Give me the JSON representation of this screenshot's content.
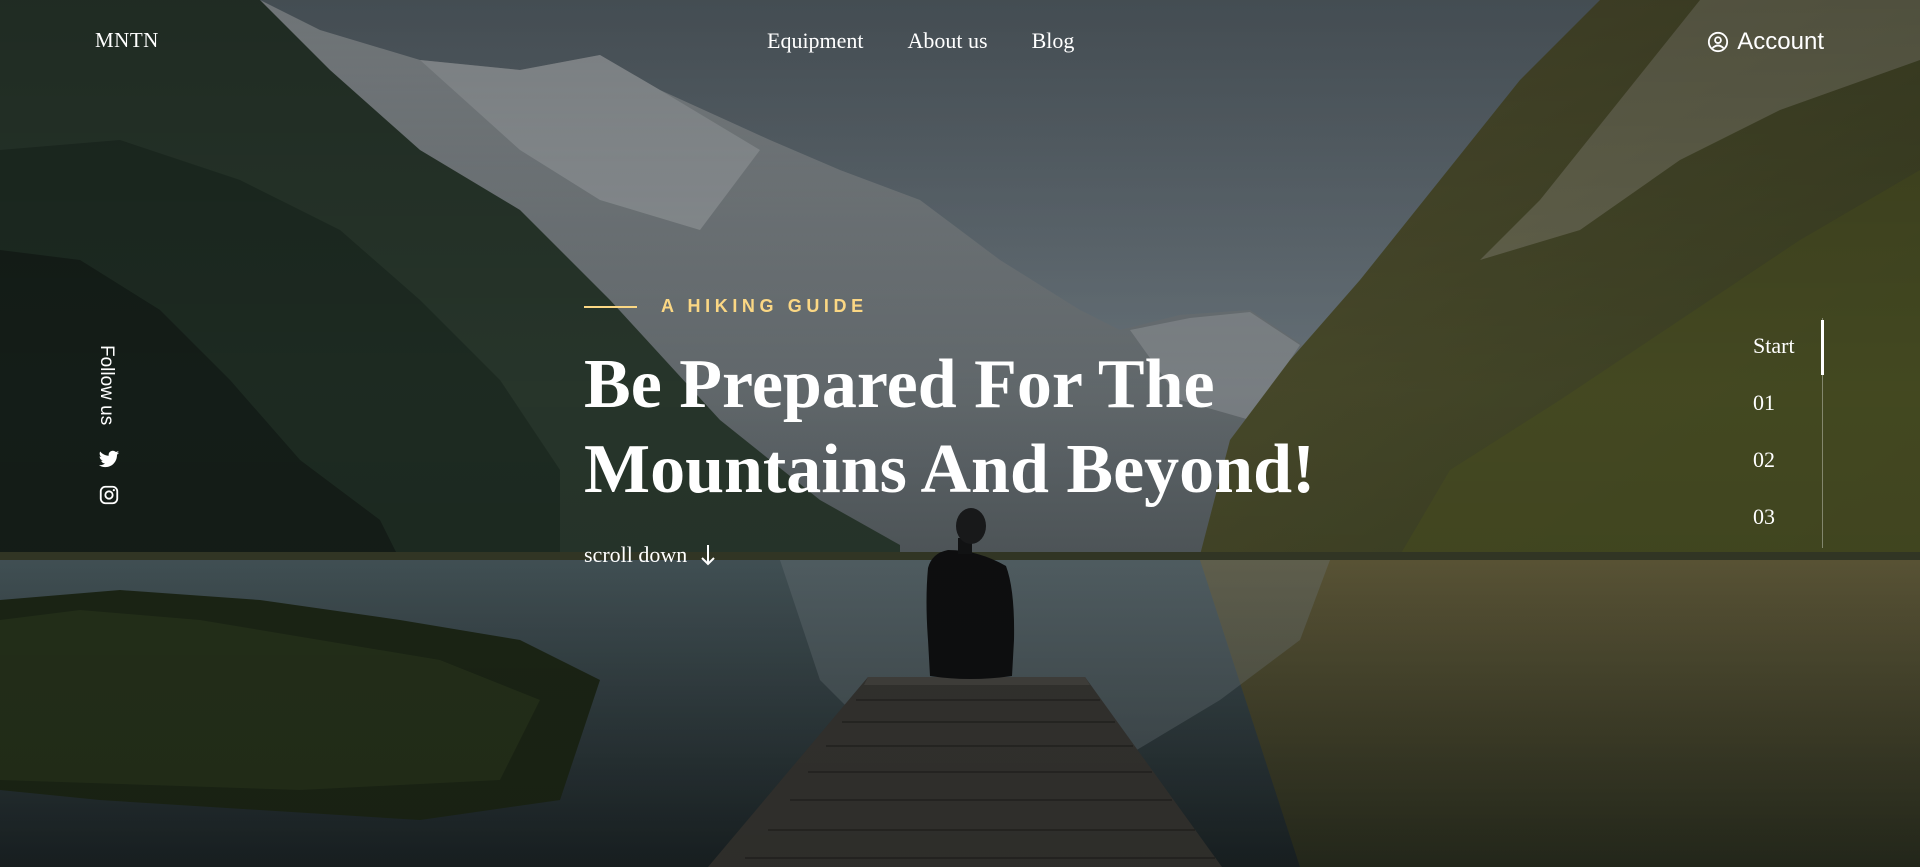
{
  "header": {
    "logo": "MNTN",
    "nav": [
      "Equipment",
      "About us",
      "Blog"
    ],
    "account_label": "Account"
  },
  "hero": {
    "eyebrow": "A HIKING GUIDE",
    "headline_line1": "Be Prepared For The",
    "headline_line2": "Mountains And Beyond!",
    "scroll_label": "scroll down"
  },
  "social": {
    "label": "Follow us",
    "icons": [
      "twitter-icon",
      "instagram-icon"
    ]
  },
  "progress": {
    "steps": [
      "Start",
      "01",
      "02",
      "03"
    ],
    "active": "Start"
  },
  "colors": {
    "accent": "#FBD784",
    "text": "#FFFFFF"
  }
}
